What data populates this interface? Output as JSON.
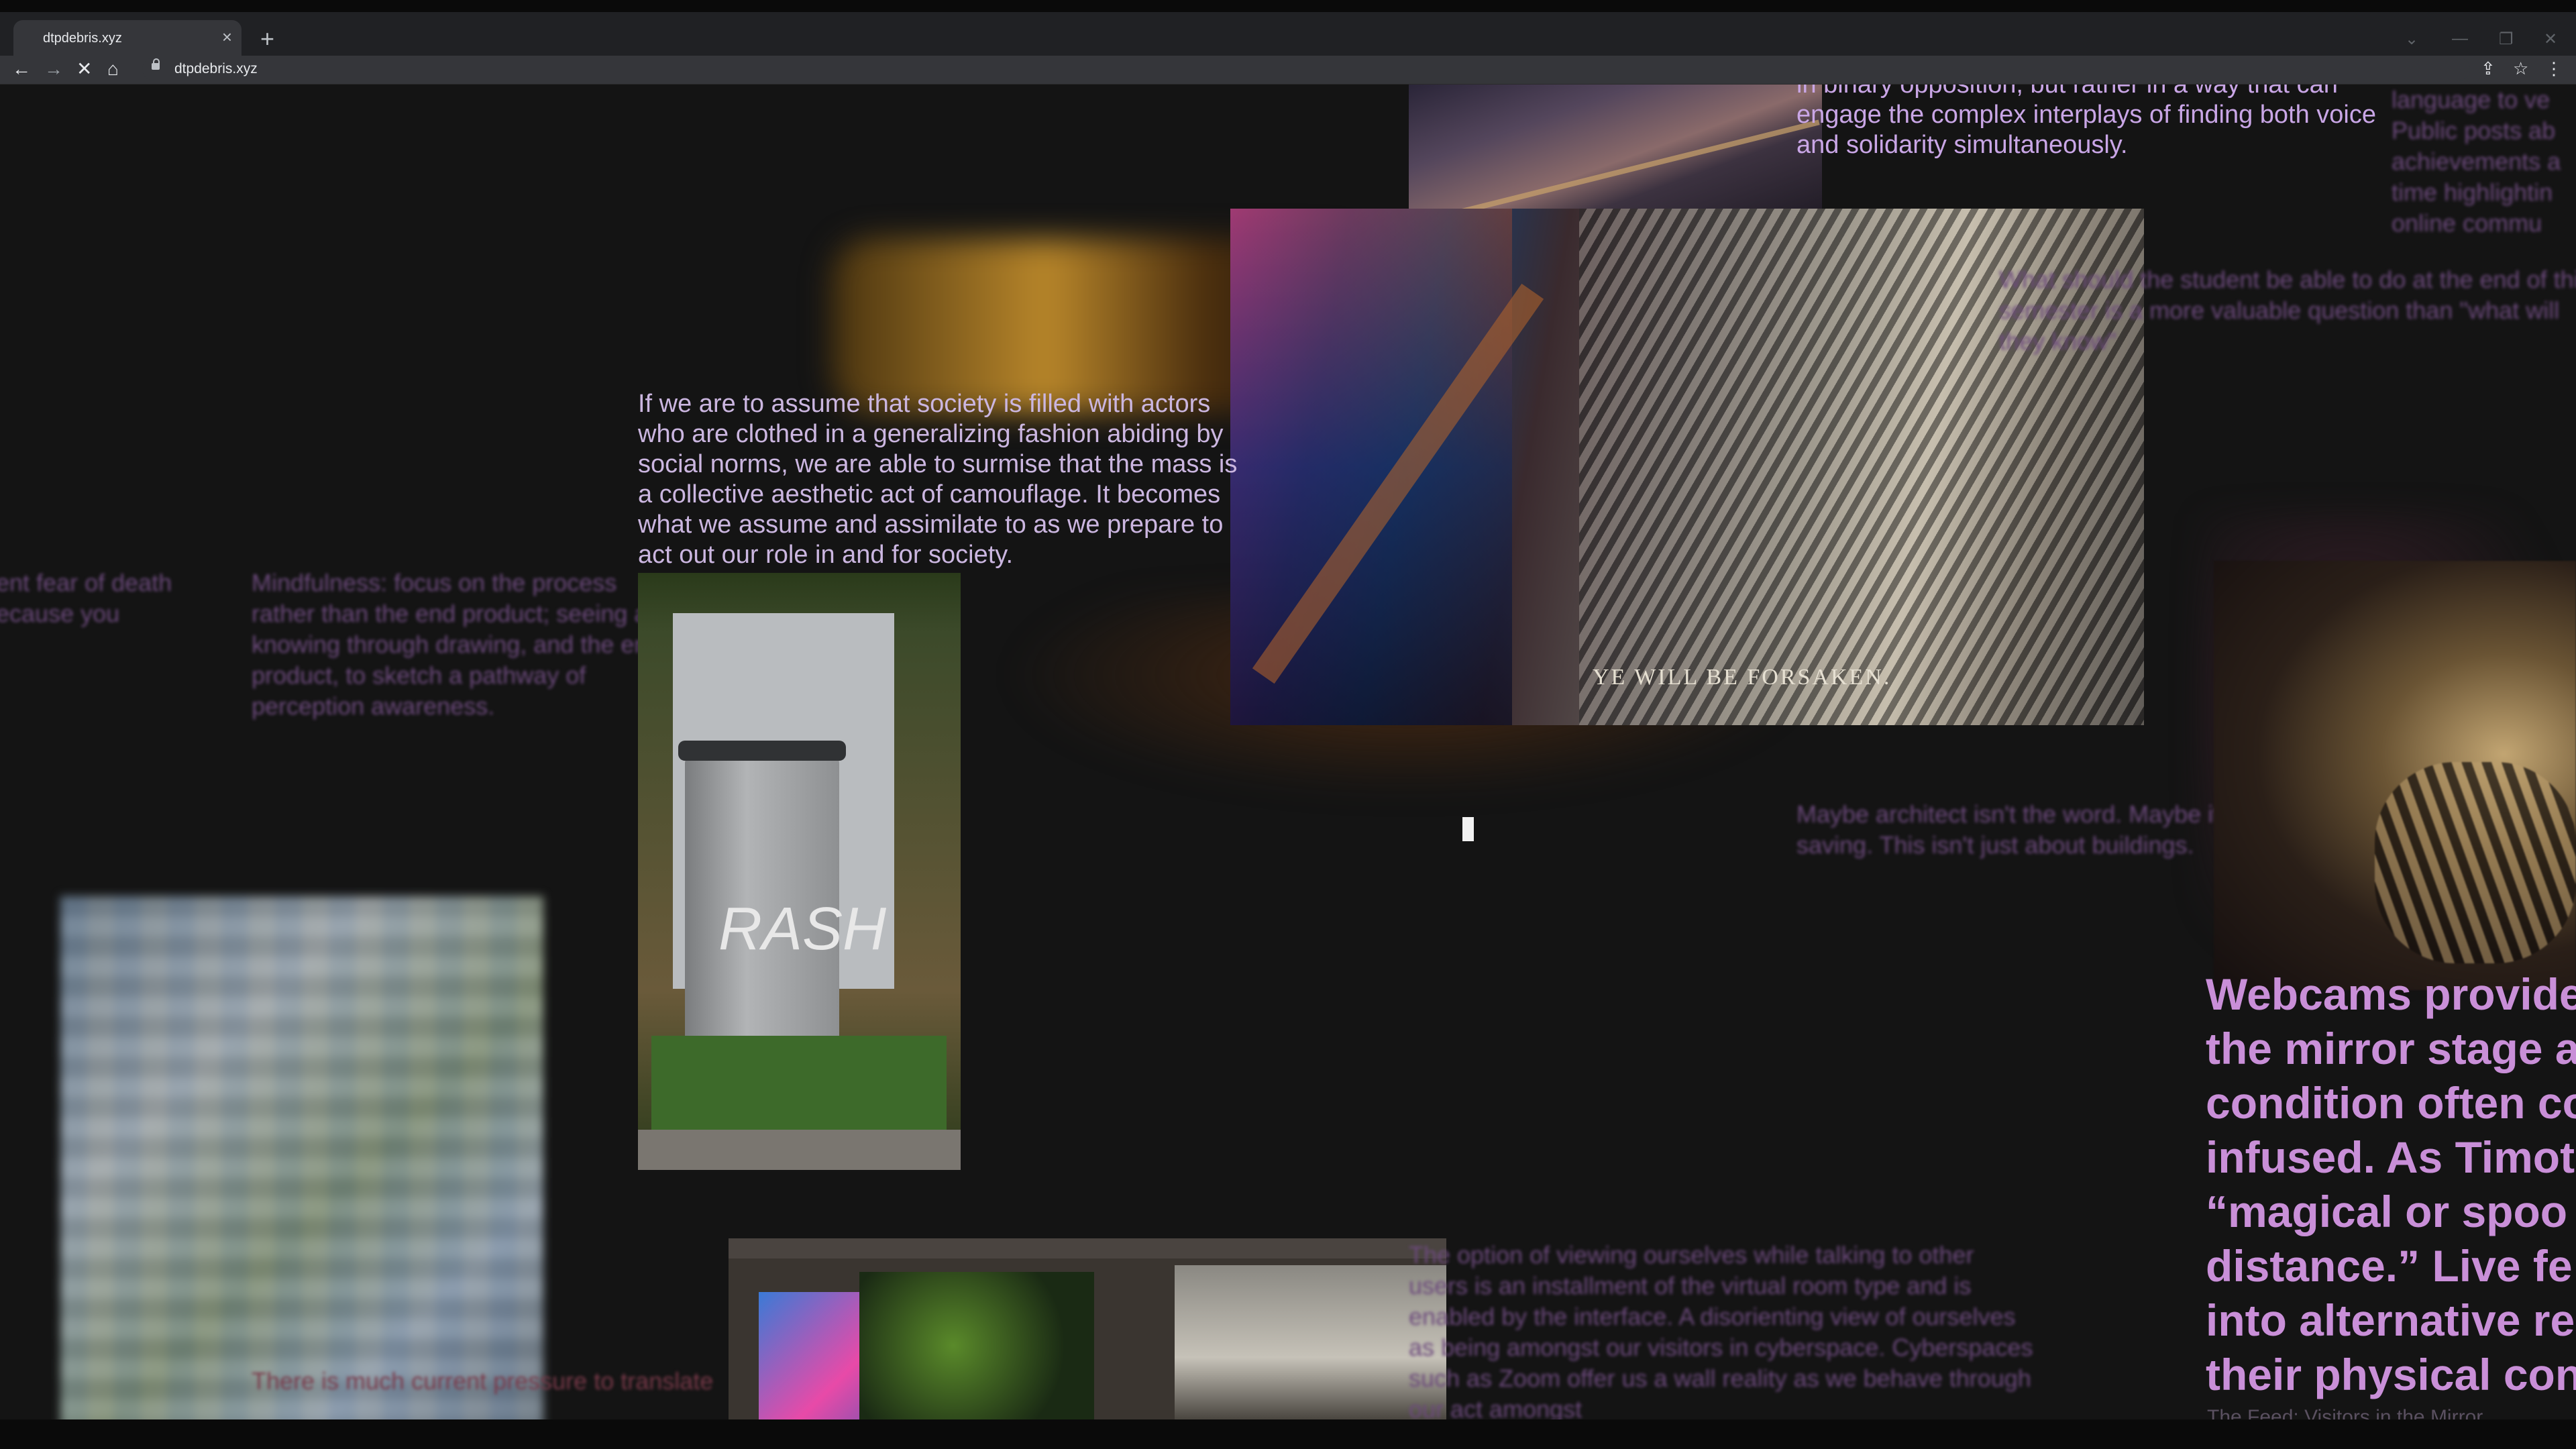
{
  "browser": {
    "tab_title": "dtpdebris.xyz",
    "tab_close": "×",
    "new_tab": "+",
    "url": "dtpdebris.xyz",
    "back": "←",
    "forward": "→",
    "stop": "✕",
    "home": "⌂",
    "share": "⇪",
    "bookmark": "☆",
    "menu": "⋮",
    "win_min": "—",
    "win_max": "❐",
    "win_close": "✕"
  },
  "content": {
    "top_quote": "in binary opposition, but rather in a way that can engage the complex interplays of finding both voice and solidarity simultaneously.",
    "society_text": "If we are to assume that society is filled with actors who are clothed in a generalizing fashion abiding by social norms, we are able to surmise that the mass is a collective aesthetic act of camouflage. It becomes what we assume and assimilate to as we prepare to act out our role in and for society.",
    "image_caption": "YE WILL BE FORSAKEN.",
    "fear_text": "ent fear of death\necause you",
    "mindfulness_text": "Mindfulness: focus on the process rather than the end product; seeing and knowing through drawing, and the end product, to sketch a pathway of perception awareness.",
    "architect_text": "Maybe architect isn't the word. Maybe it's not worth saving. This isn't just about buildings.",
    "right_top_text": "language to ve\nPublic posts ab\nachievements a\ntime highlightin\nonline commu",
    "student_text": "What should the student be able to do at the end of this semester is a more valuable question than \"what will they know\"",
    "webcam_text": "Webcams provide\nthe mirror stage a\ncondition often co\ninfused. As Timot\n“magical or spoo\ndistance.” Live fe\ninto alternative re\ntheir physical con",
    "webcam_caption": "The Feed: Visitors in the Mirror",
    "viewing_text": "The option of viewing ourselves while talking to other users is an installment of the virtual room type and is enabled by the interface. A disorienting view of ourselves as being amongst our visitors in cyberspace. Cyberspaces such as Zoom offer us a wall reality as we behave through our act amongst",
    "pressure_text": "There is much current pressure to translate",
    "accent_color": "#c98fd8"
  }
}
